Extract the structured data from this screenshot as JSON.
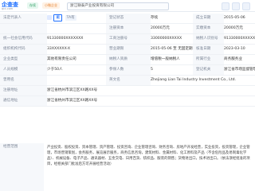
{
  "header": {
    "logo": "企查查",
    "logo_sub": "qcc.com",
    "pill_status": "存续",
    "pill_tag": "小微企业",
    "search_text": "浙江联泰产业投资有限公司"
  },
  "rows": [
    {
      "l1": "法定代表人",
      "v1_avatar": true,
      "v1": "戴",
      "v1_tag": "TA有",
      "l2": "登记状态",
      "v2": "存续",
      "l3": "成立日期",
      "v3": "2015-05-06"
    },
    {
      "l1": "",
      "v1": "",
      "l2": "注册资本",
      "v2": "20000万元",
      "l3": "实缴资本",
      "v3": "20000万元"
    },
    {
      "l1": "统一社会信用代码",
      "v1": "91330000XXXXXXX",
      "l2": "工商注册号",
      "v2": "33000000XXXXX",
      "l3": "纳税人识别号",
      "v3": "91330000XXXXX"
    },
    {
      "l1": "组织机构代码",
      "v1": "33XXXXXX-X",
      "l2": "营业期限",
      "v2": "2015-05-06 至 无固定期限",
      "l3": "核准日期",
      "v3": "2023-03-10"
    },
    {
      "l1": "企业类型",
      "v1": "其他有限责任公司",
      "l2": "纳税人资质",
      "v2": "增值税一般纳税人",
      "l3": "所属行业",
      "v3": "商务服务业"
    },
    {
      "l1": "人员规模",
      "v1": "少于50人",
      "l2": "参保人数",
      "v2": "5",
      "l3": "登记机关",
      "v3": "浙江省市场监督管理局"
    },
    {
      "l1": "曾用名",
      "v1": "",
      "l2": "英文名",
      "v2": "Zhejiang Lian Tai Industry Investment Co., Ltd.",
      "l3": "",
      "v3": ""
    },
    {
      "l1": "注册地址",
      "v1": "浙江省杭州市滨江区XX路XX号",
      "l2": "",
      "v2": "",
      "l3": "",
      "v3": ""
    },
    {
      "l1": "通信地址",
      "v1": "浙江省杭州市滨江区XX路XX号",
      "l2": "",
      "v2": "",
      "l3": "",
      "v3": ""
    }
  ],
  "scope": {
    "label": "经营范围",
    "text": "产业投资、股权投资、资本管理、资产管理、投资咨询、企业管理咨询、财务咨询、房地产开发经营，实业投资，投资管理，企业管理，市场营销策划，会务服务，展览展示服务，商务信息咨询，建筑材料、金属材料、化工原料及产品（不含危险品及易制毒化学品）、机械设备、电子产品、通讯器材、五金交电、日用百货、纺织品、服装的销售；货物进出口，技术进出口。（依法须经批准的项目，经相关部门批准后方可开展经营活动）"
  }
}
